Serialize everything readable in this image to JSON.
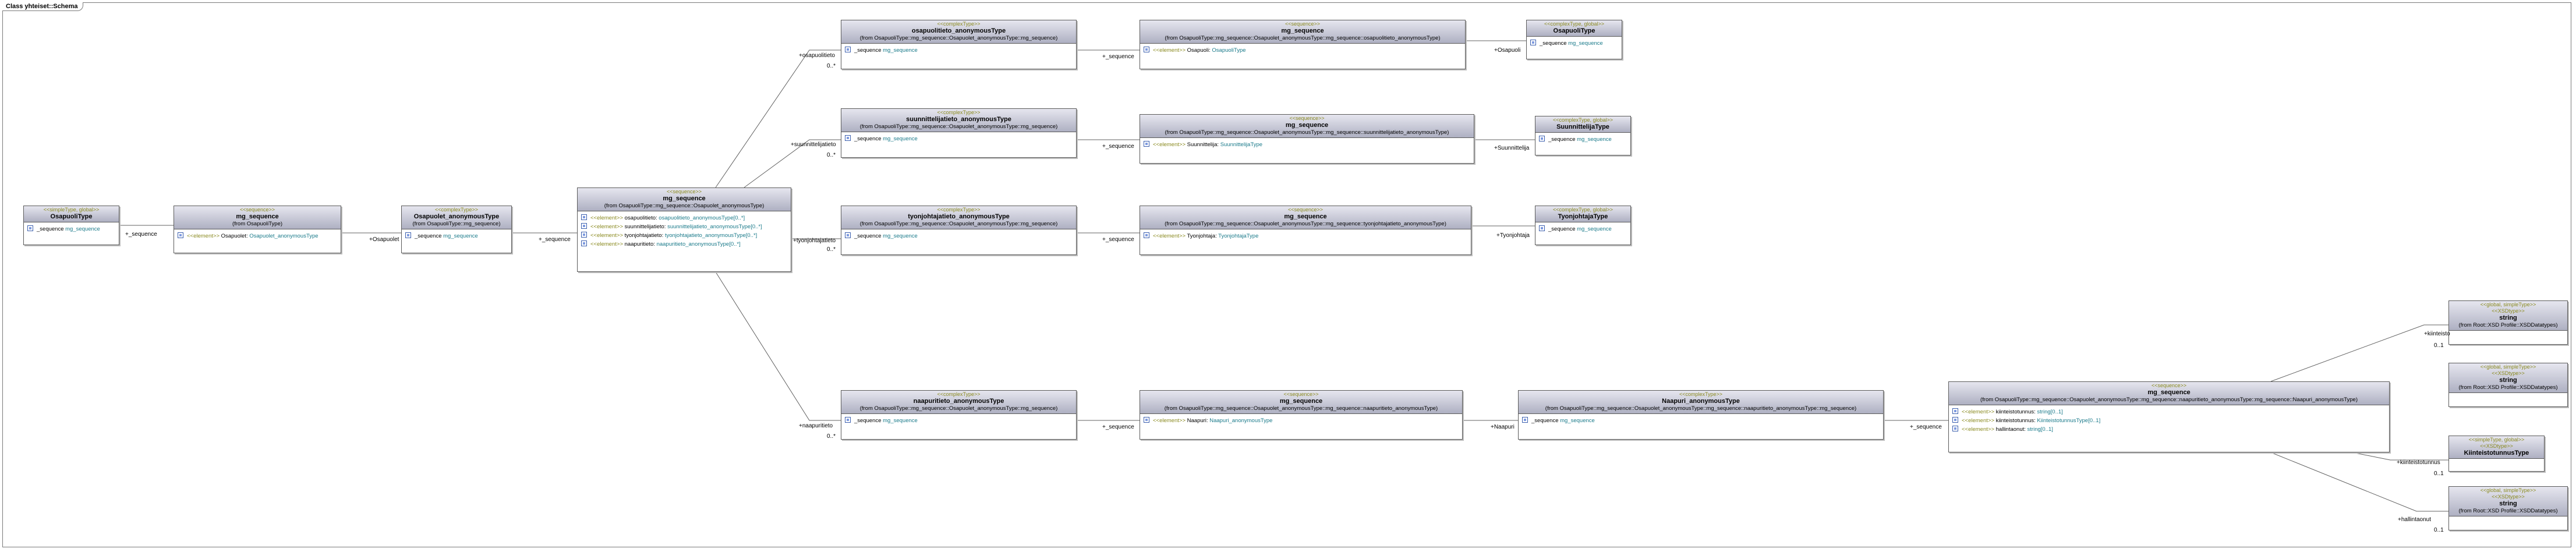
{
  "frame": {
    "title": "Class yhteiset::Schema"
  },
  "nodes": {
    "osapuolitype": {
      "stereotype": "<<simpleType, global>>",
      "name": "OsapuoliType",
      "rows": [
        {
          "prefix": "_sequence",
          "type": "mg_sequence"
        }
      ]
    },
    "seq_top": {
      "stereotype": "<<sequence>>",
      "name": "mg_sequence",
      "from": "(from OsapuoliType)",
      "rows": [
        {
          "prefix": "<<element>>",
          "name": "Osapuolet",
          "type": "Osapuolet_anonymousType"
        }
      ]
    },
    "osapuolet_anon": {
      "stereotype": "<<complexType>>",
      "name": "Osapuolet_anonymousType",
      "from": "(from OsapuoliType::mg_sequence)",
      "rows": [
        {
          "prefix": "_sequence",
          "type": "mg_sequence"
        }
      ]
    },
    "seq_main": {
      "stereotype": "<<sequence>>",
      "name": "mg_sequence",
      "from": "(from OsapuoliType::mg_sequence::Osapuolet_anonymousType)",
      "rows": [
        {
          "prefix": "<<element>>",
          "name": "osapuolitieto",
          "type": "osapuolitieto_anonymousType",
          "mult": "[0..*]"
        },
        {
          "prefix": "<<element>>",
          "name": "suunnittelijatieto",
          "type": "suunnittelijatieto_anonymousType",
          "mult": "[0..*]"
        },
        {
          "prefix": "<<element>>",
          "name": "tyonjohtajatieto",
          "type": "tyonjohtajatieto_anonymousType",
          "mult": "[0..*]"
        },
        {
          "prefix": "<<element>>",
          "name": "naapuritieto",
          "type": "naapuritieto_anonymousType",
          "mult": "[0..*]"
        }
      ]
    },
    "osapuolitieto_anon": {
      "stereotype": "<<complexType>>",
      "name": "osapuolitieto_anonymousType",
      "from": "(from OsapuoliType::mg_sequence::Osapuolet_anonymousType::mg_sequence)",
      "rows": [
        {
          "prefix": "_sequence",
          "type": "mg_sequence"
        }
      ]
    },
    "seq_osapuoli": {
      "stereotype": "<<sequence>>",
      "name": "mg_sequence",
      "from": "(from OsapuoliType::mg_sequence::Osapuolet_anonymousType::mg_sequence::osapuolitieto_anonymousType)",
      "rows": [
        {
          "prefix": "<<element>>",
          "name": "Osapuoli",
          "type": "OsapuoliType"
        }
      ]
    },
    "osapuoli_type": {
      "stereotype": "<<complexType, global>>",
      "name": "OsapuoliType",
      "rows": [
        {
          "prefix": "_sequence",
          "type": "mg_sequence"
        }
      ]
    },
    "suunnittelijatieto_anon": {
      "stereotype": "<<complexType>>",
      "name": "suunnittelijatieto_anonymousType",
      "from": "(from OsapuoliType::mg_sequence::Osapuolet_anonymousType::mg_sequence)",
      "rows": [
        {
          "prefix": "_sequence",
          "type": "mg_sequence"
        }
      ]
    },
    "seq_suunnittelija": {
      "stereotype": "<<sequence>>",
      "name": "mg_sequence",
      "from": "(from OsapuoliType::mg_sequence::Osapuolet_anonymousType::mg_sequence::suunnittelijatieto_anonymousType)",
      "rows": [
        {
          "prefix": "<<element>>",
          "name": "Suunnittelija",
          "type": "SuunnittelijaType"
        }
      ]
    },
    "suunnittelija_type": {
      "stereotype": "<<complexType, global>>",
      "name": "SuunnittelijaType",
      "rows": [
        {
          "prefix": "_sequence",
          "type": "mg_sequence"
        }
      ]
    },
    "tyonjohtajatieto_anon": {
      "stereotype": "<<complexType>>",
      "name": "tyonjohtajatieto_anonymousType",
      "from": "(from OsapuoliType::mg_sequence::Osapuolet_anonymousType::mg_sequence)",
      "rows": [
        {
          "prefix": "_sequence",
          "type": "mg_sequence"
        }
      ]
    },
    "seq_tyonjohtaja": {
      "stereotype": "<<sequence>>",
      "name": "mg_sequence",
      "from": "(from OsapuoliType::mg_sequence::Osapuolet_anonymousType::mg_sequence::tyonjohtajatieto_anonymousType)",
      "rows": [
        {
          "prefix": "<<element>>",
          "name": "Tyonjohtaja",
          "type": "TyonjohtajaType"
        }
      ]
    },
    "tyonjohtaja_type": {
      "stereotype": "<<complexType, global>>",
      "name": "TyonjohtajaType",
      "rows": [
        {
          "prefix": "_sequence",
          "type": "mg_sequence"
        }
      ]
    },
    "naapuritieto_anon": {
      "stereotype": "<<complexType>>",
      "name": "naapuritieto_anonymousType",
      "from": "(from OsapuoliType::mg_sequence::Osapuolet_anonymousType::mg_sequence)",
      "rows": [
        {
          "prefix": "_sequence",
          "type": "mg_sequence"
        }
      ]
    },
    "seq_naapuri": {
      "stereotype": "<<sequence>>",
      "name": "mg_sequence",
      "from": "(from OsapuoliType::mg_sequence::Osapuolet_anonymousType::mg_sequence::naapuritieto_anonymousType)",
      "rows": [
        {
          "prefix": "<<element>>",
          "name": "Naapuri",
          "type": "Naapuri_anonymousType"
        }
      ]
    },
    "naapuri_anon": {
      "stereotype": "<<complexType>>",
      "name": "Naapuri_anonymousType",
      "from": "(from OsapuoliType::mg_sequence::Osapuolet_anonymousType::mg_sequence::naapuritieto_anonymousType::mg_sequence)",
      "rows": [
        {
          "prefix": "_sequence",
          "type": "mg_sequence"
        }
      ]
    },
    "seq_naapuri_inner": {
      "stereotype": "<<sequence>>",
      "name": "mg_sequence",
      "from": "(from OsapuoliType::mg_sequence::Osapuolet_anonymousType::mg_sequence::naapuritieto_anonymousType::mg_sequence::Naapuri_anonymousType)",
      "rows": [
        {
          "prefix": "<<element>>",
          "name": "kiinteistotunnus",
          "type": "string",
          "mult": "[0..1]"
        },
        {
          "prefix": "<<element>>",
          "name": "kiinteistotunnus",
          "type": "KiinteistotunnusType",
          "mult": "[0..1]"
        },
        {
          "prefix": "<<element>>",
          "name": "hallintaonut",
          "type": "string",
          "mult": "[0..1]"
        }
      ]
    },
    "string1": {
      "stereotype": "<<global, simpleType>>",
      "stereotype2": "<<XSDtype>>",
      "name": "string",
      "from": "(from Root::XSD Profile::XSDDatatypes)"
    },
    "string2": {
      "stereotype": "<<global, simpleType>>",
      "stereotype2": "<<XSDtype>>",
      "name": "string",
      "from": "(from Root::XSD Profile::XSDDatatypes)"
    },
    "kiinteistotunnus_type": {
      "stereotype": "<<simpleType, global>>",
      "stereotype2": "<<XSDtype>>",
      "name": "KiinteistotunnusType"
    },
    "string3": {
      "stereotype": "<<global, simpleType>>",
      "stereotype2": "<<XSDtype>>",
      "name": "string",
      "from": "(from Root::XSD Profile::XSDDatatypes)"
    }
  },
  "edges": [
    {
      "role": "+_sequence",
      "mult": ""
    },
    {
      "role": "+Osapuolet",
      "mult": ""
    },
    {
      "role": "+_sequence",
      "mult": ""
    },
    {
      "role": "+osapuolitieto",
      "mult": "0..*"
    },
    {
      "role": "+suunnittelijatieto",
      "mult": "0..*"
    },
    {
      "role": "+tyonjohtajatieto",
      "mult": "0..*"
    },
    {
      "role": "+naapuritieto",
      "mult": "0..*"
    },
    {
      "role": "+_sequence",
      "mult": ""
    },
    {
      "role": "+Osapuoli",
      "mult": ""
    },
    {
      "role": "+_sequence",
      "mult": ""
    },
    {
      "role": "+Suunnittelija",
      "mult": ""
    },
    {
      "role": "+_sequence",
      "mult": ""
    },
    {
      "role": "+Tyonjohtaja",
      "mult": ""
    },
    {
      "role": "+_sequence",
      "mult": ""
    },
    {
      "role": "+Naapuri",
      "mult": ""
    },
    {
      "role": "+_sequence",
      "mult": ""
    },
    {
      "role": "+kiinteisto",
      "mult": "0..1"
    },
    {
      "role": "+kiinteistotunnus",
      "mult": "0..1"
    },
    {
      "role": "+hallintaonut",
      "mult": "0..1"
    }
  ]
}
